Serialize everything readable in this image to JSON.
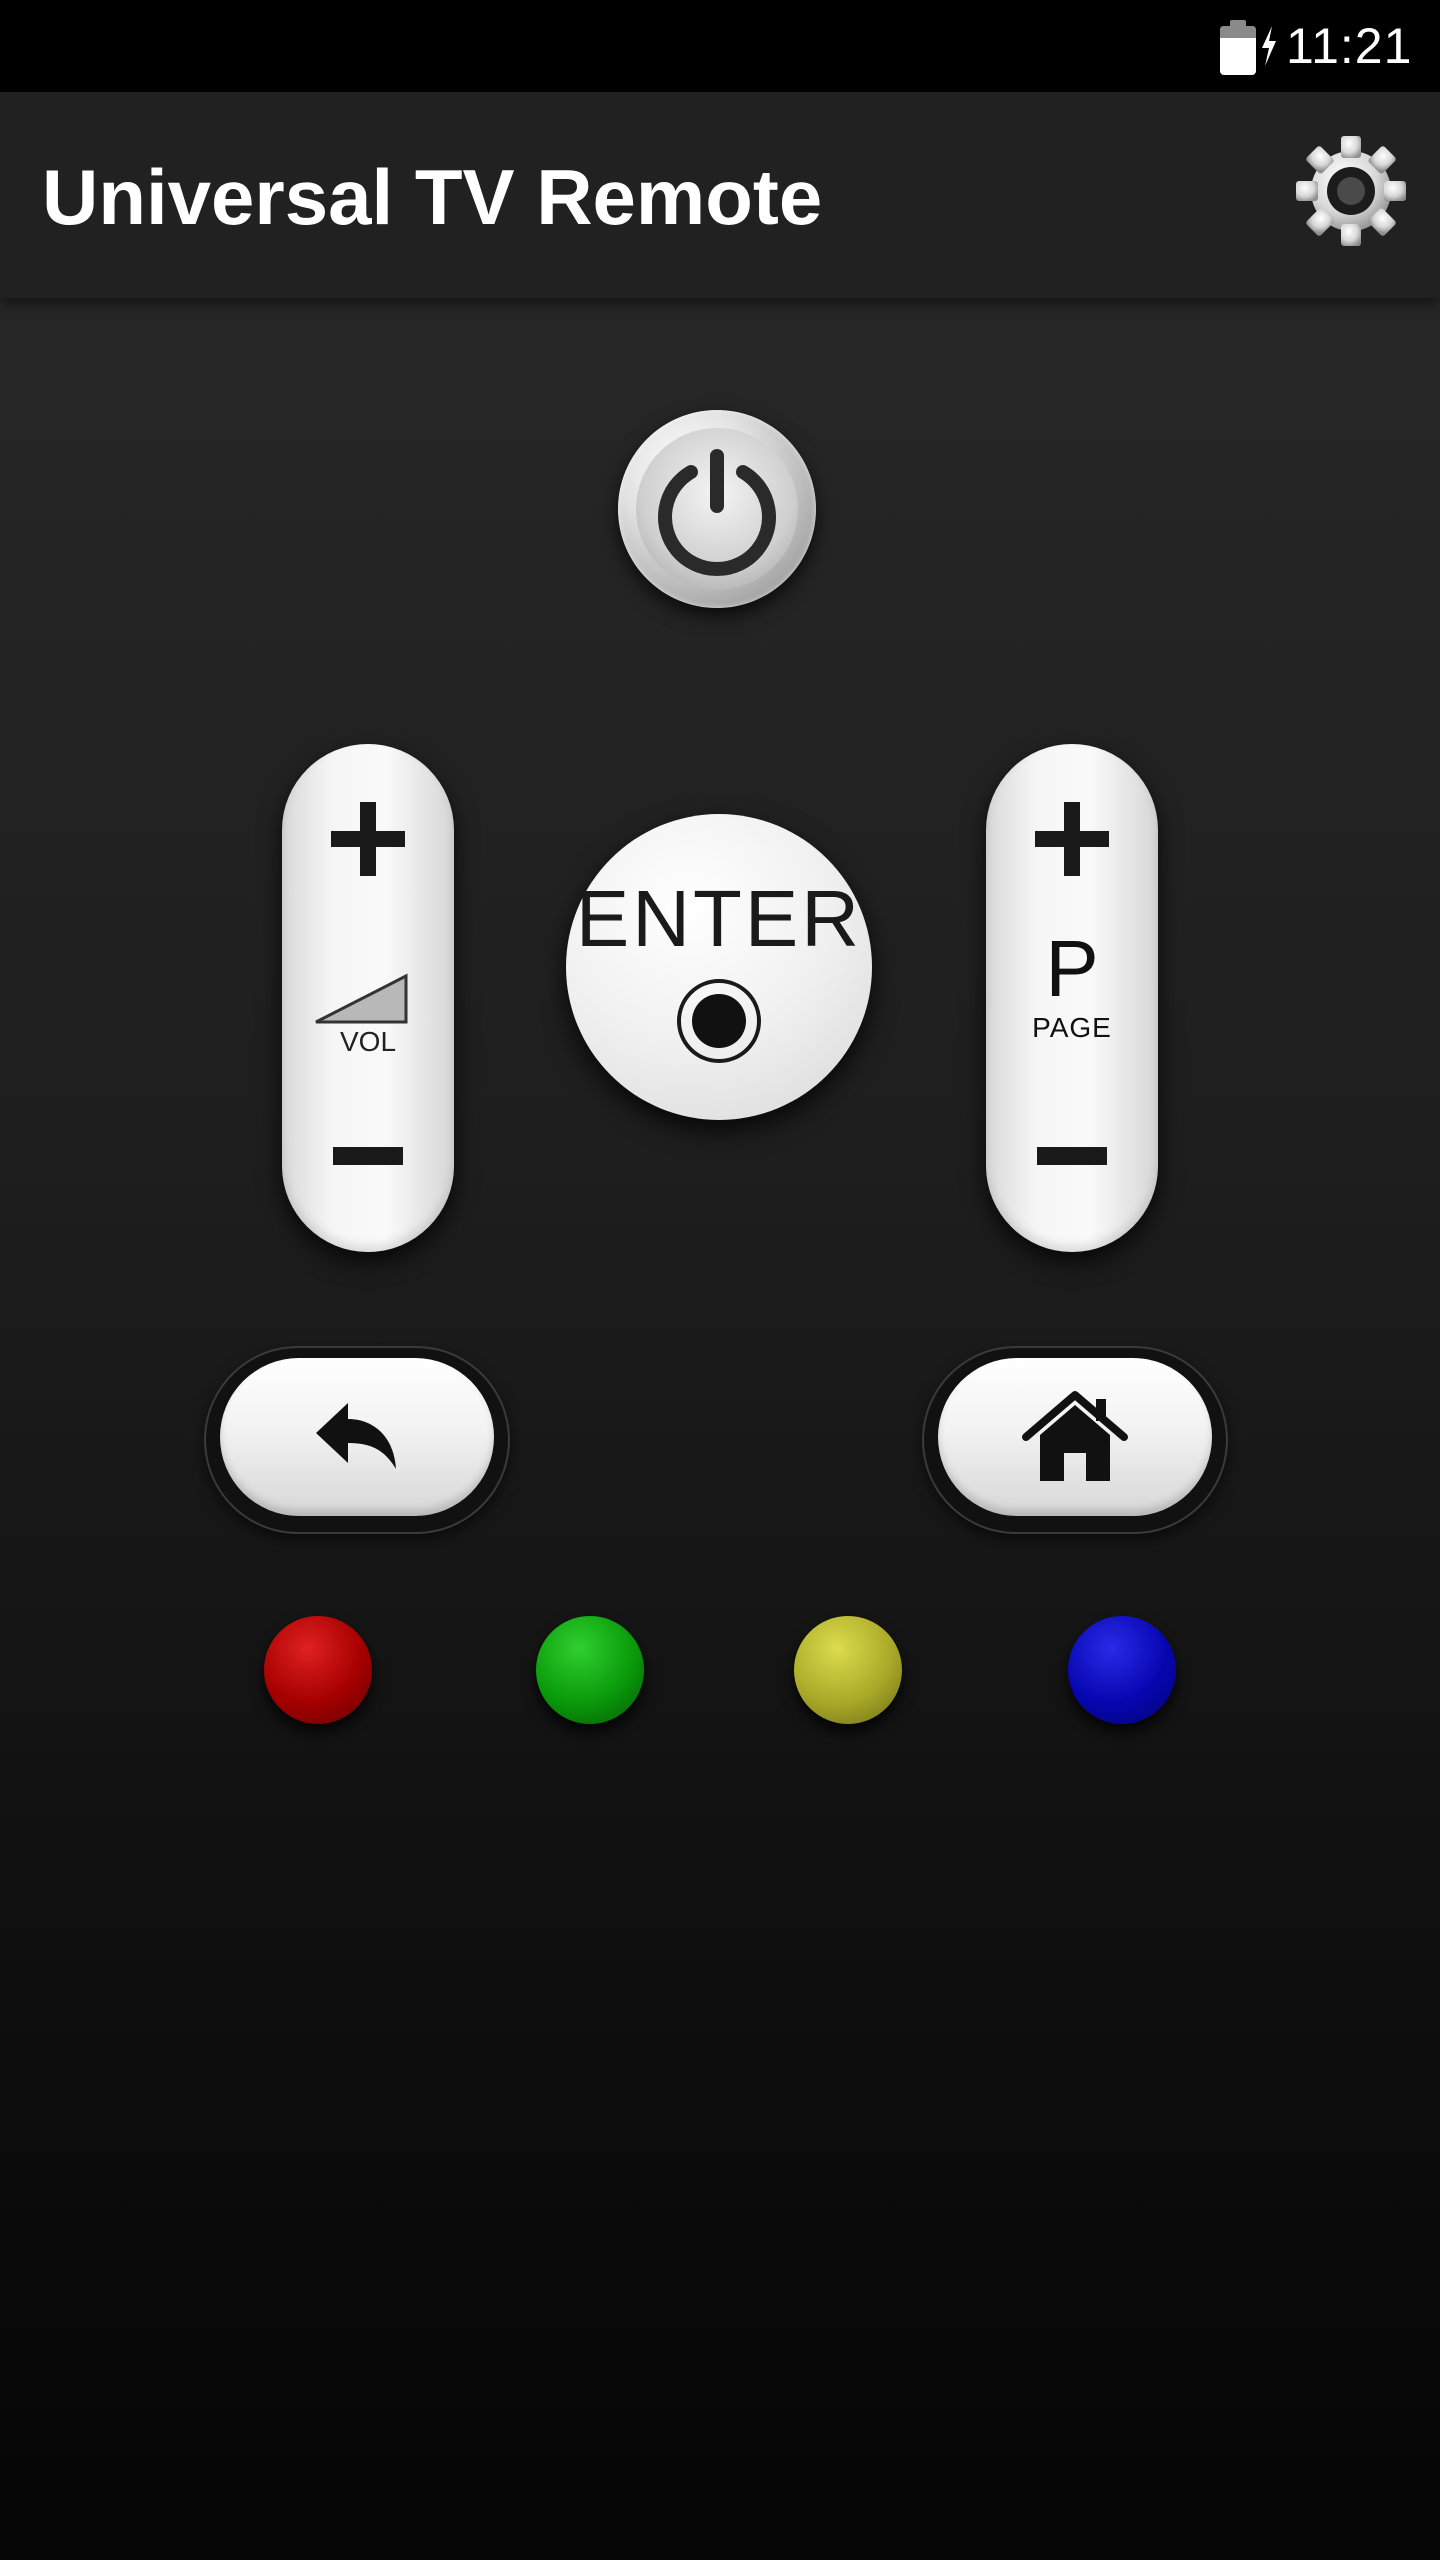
{
  "status_bar": {
    "time": "11:21",
    "battery_level": 0.75,
    "charging": true,
    "icons": [
      "battery-icon",
      "charging-bolt-icon"
    ]
  },
  "app_bar": {
    "title": "Universal TV Remote",
    "actions": [
      "settings-gear-icon"
    ]
  },
  "remote": {
    "power": {
      "icon": "power-icon"
    },
    "volume": {
      "label": "VOL",
      "up_icon": "plus-icon",
      "down_icon": "minus-icon",
      "level_icon": "volume-wedge-icon"
    },
    "enter": {
      "label": "ENTER",
      "icon": "record-dot-icon"
    },
    "page": {
      "letter": "P",
      "label": "PAGE",
      "up_icon": "plus-icon",
      "down_icon": "minus-icon"
    },
    "navigation": [
      {
        "name": "back",
        "icon": "back-arrow-icon"
      },
      {
        "name": "home",
        "icon": "home-icon"
      }
    ],
    "color_buttons": [
      {
        "name": "red",
        "color": "#a50000"
      },
      {
        "name": "green",
        "color": "#0a9a0a"
      },
      {
        "name": "yellow",
        "color": "#a9a929"
      },
      {
        "name": "blue",
        "color": "#0606b0"
      }
    ]
  }
}
